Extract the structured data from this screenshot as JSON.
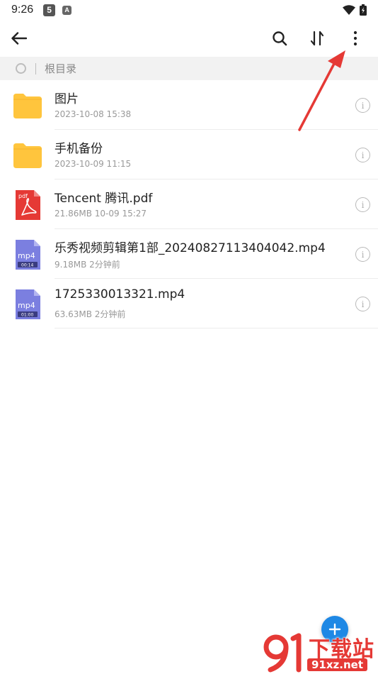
{
  "status_bar": {
    "time": "9:26",
    "badge_1": "5",
    "badge_2": "A"
  },
  "toolbar": {
    "back_icon": "arrow-left-icon",
    "search_icon": "search-icon",
    "sort_icon": "sort-icon",
    "more_icon": "more-vertical-icon"
  },
  "breadcrumb": {
    "label": "根目录"
  },
  "files": [
    {
      "type": "folder",
      "name": "图片",
      "meta": "2023-10-08 15:38"
    },
    {
      "type": "folder",
      "name": "手机备份",
      "meta": "2023-10-09 11:15"
    },
    {
      "type": "pdf",
      "name": "Tencent 腾讯.pdf",
      "meta": "21.86MB   10-09 15:27",
      "ext_label": "pdf"
    },
    {
      "type": "mp4",
      "name": "乐秀视频剪辑第1部_20240827113404042.mp4",
      "meta": "9.18MB   2分钟前",
      "ext_label": "mp4",
      "duration": "00:14"
    },
    {
      "type": "mp4",
      "name": "1725330013321.mp4",
      "meta": "63.63MB   2分钟前",
      "ext_label": "mp4",
      "duration": "01:00"
    }
  ],
  "info_glyph": "i",
  "watermark": {
    "title": "下载站",
    "url": "91xz.net"
  },
  "colors": {
    "folder": "#FFC53D",
    "pdf": "#E53935",
    "video": "#7B7FE0",
    "fab": "#1E88E5",
    "arrow": "#E53935"
  }
}
